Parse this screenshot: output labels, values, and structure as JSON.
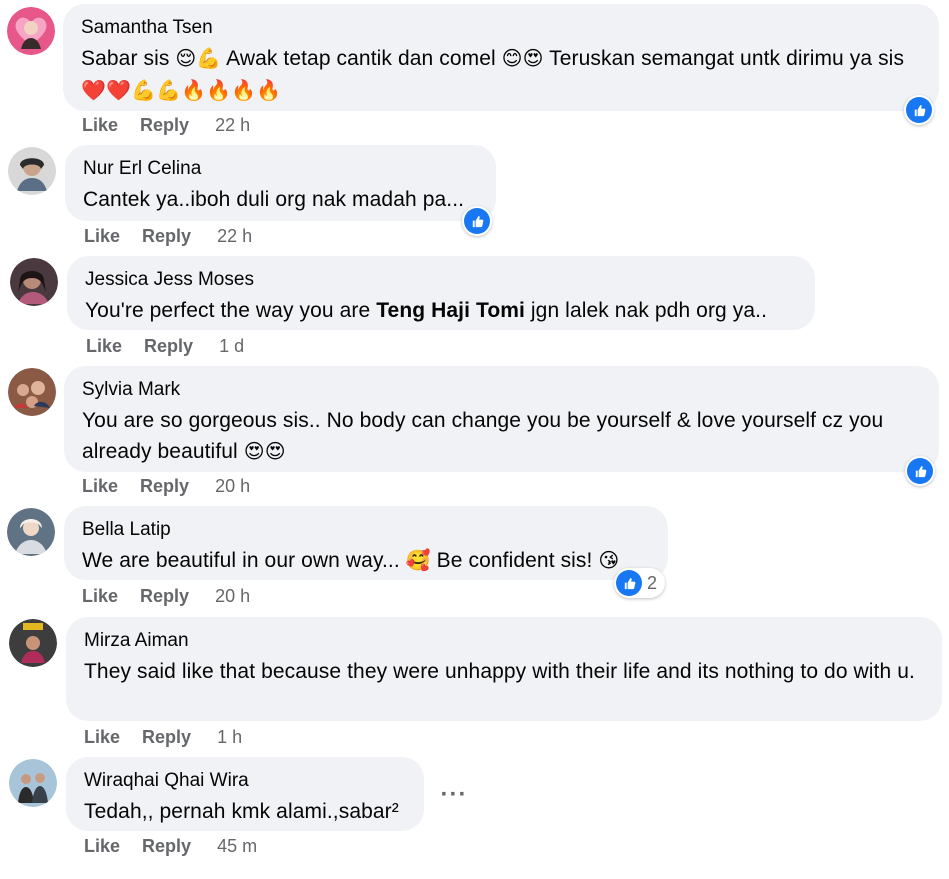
{
  "comments": [
    {
      "author": "Samantha Tsen",
      "text_a": "Sabar sis ",
      "emoji_a": "😌💪",
      "text_b": " Awak tetap cantik dan comel ",
      "emoji_b": "😊😍",
      "text_c": " Teruskan semangat untk dirimu ya sis ",
      "emoji_c": "❤️❤️💪💪🔥🔥🔥🔥",
      "like": "Like",
      "reply": "Reply",
      "time": "22 h"
    },
    {
      "author": "Nur Erl Celina",
      "text_a": "Cantek ya..iboh duli org nak madah pa...",
      "like": "Like",
      "reply": "Reply",
      "time": "22 h"
    },
    {
      "author": "Jessica Jess Moses",
      "text_a": "You're perfect the way you are ",
      "mention": "Teng Haji Tomi",
      "text_b": " jgn lalek nak pdh org ya..",
      "like": "Like",
      "reply": "Reply",
      "time": "1 d"
    },
    {
      "author": "Sylvia Mark",
      "text_a": "You are so gorgeous sis.. No body can change you be yourself & love yourself cz you already beautiful ",
      "emoji_a": "😍😍",
      "like": "Like",
      "reply": "Reply",
      "time": "20 h"
    },
    {
      "author": "Bella Latip",
      "text_a": "We are beautiful in our own way... ",
      "emoji_a": "🥰",
      "text_b": " Be confident sis! ",
      "emoji_b": "😘",
      "reaction_count": "2",
      "like": "Like",
      "reply": "Reply",
      "time": "20 h"
    },
    {
      "author": "Mirza Aiman",
      "text_a": "They said like that because they were unhappy with their life and its nothing to do with u.",
      "like": "Like",
      "reply": "Reply",
      "time": "1 h"
    },
    {
      "author": "Wiraqhai Qhai Wira",
      "text_a": "Tedah,, pernah kmk alami.,sabar²",
      "like": "Like",
      "reply": "Reply",
      "time": "45 m",
      "more": "···"
    }
  ],
  "colors": {
    "like_blue": "#1877f2",
    "bubble_bg": "#f0f2f5",
    "meta_gray": "#65676b"
  }
}
